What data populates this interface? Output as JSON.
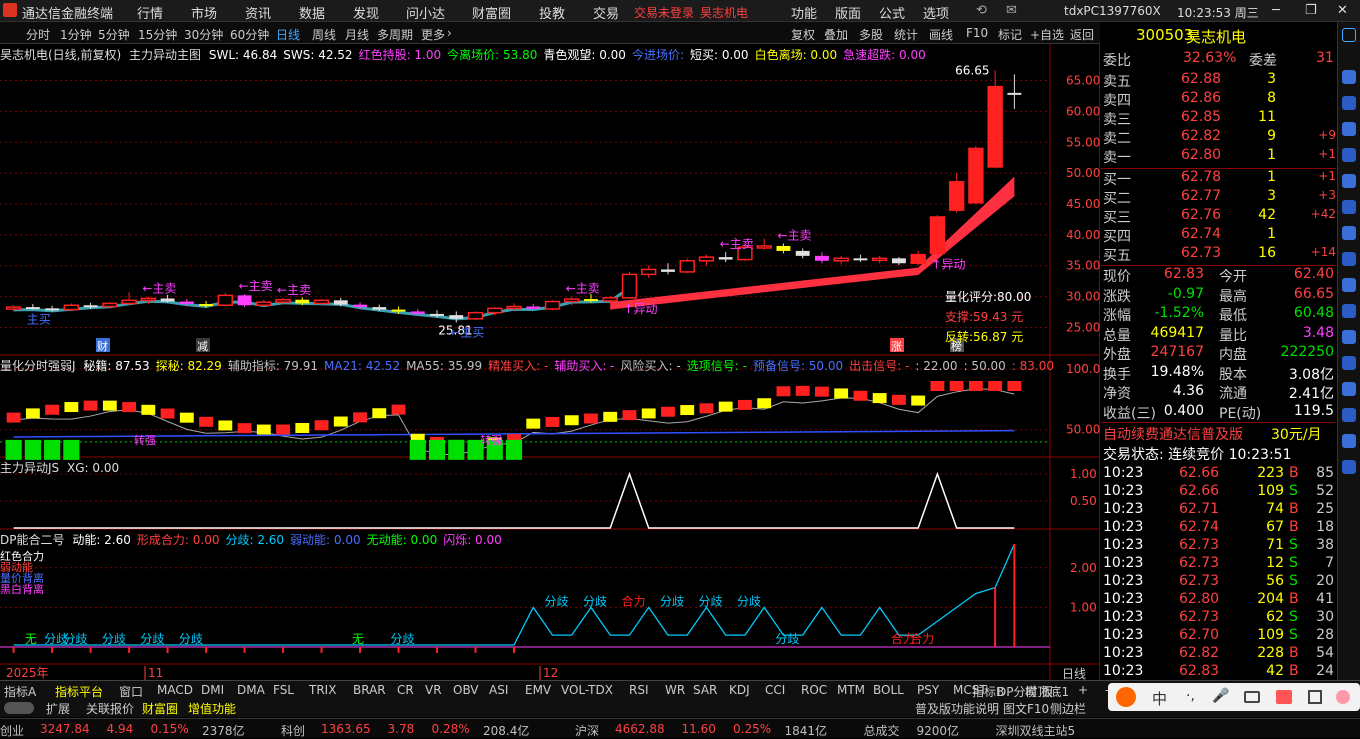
{
  "titlebar": {
    "app_name": "通达信金融终端",
    "menu": [
      "行情",
      "市场",
      "资讯",
      "数据",
      "发现",
      "问小达",
      "财富圈",
      "投教",
      "交易"
    ],
    "trade_notice": "交易未登录",
    "stock_name": "昊志机电",
    "right_menu": [
      "功能",
      "版面",
      "公式",
      "选项"
    ],
    "pc_id": "tdxPC1397760X",
    "clock": "10:23:53 周三"
  },
  "toolbar": {
    "periods": [
      "分时",
      "1分钟",
      "5分钟",
      "15分钟",
      "30分钟",
      "60分钟",
      "日线",
      "周线",
      "月线",
      "多周期",
      "更多"
    ],
    "active_period": "日线",
    "buttons": [
      "复权",
      "叠加",
      "多股",
      "统计",
      "画线",
      "F10",
      "标记",
      "+自选",
      "返回"
    ]
  },
  "main_chart": {
    "header": [
      "昊志机电(日线,前复权)",
      "主力异动主图"
    ],
    "indicators": [
      {
        "text": "SWL: 46.84",
        "color": "#ffffff"
      },
      {
        "text": "SWS: 42.52",
        "color": "#ffffff"
      },
      {
        "text": "红色持股: 1.00",
        "color": "#ff40ff"
      },
      {
        "text": "今离场价: 53.80",
        "color": "#00ff00"
      },
      {
        "text": "青色观望: 0.00",
        "color": "#ffffff"
      },
      {
        "text": "今进场价:",
        "color": "#4a6fff"
      },
      {
        "text": "短买: 0.00",
        "color": "#ffffff"
      },
      {
        "text": "白色离场: 0.00",
        "color": "#ffff00"
      },
      {
        "text": "急速超跌: 0.00",
        "color": "#ff40ff"
      }
    ],
    "price_axis": [
      "65.00",
      "60.00",
      "55.00",
      "50.00",
      "45.00",
      "40.00",
      "35.00",
      "30.00",
      "25.00"
    ],
    "high_label": "66.65",
    "low_label": "25.81",
    "quant_score": "量化评分:80.00",
    "support": "支撑:59.43 元",
    "reversal": "反转:56.87 元",
    "annotations": [
      "←主卖",
      "←主卖",
      "←主卖",
      "←主卖",
      "←主卖",
      "←主卖",
      "主买",
      "←主买",
      "↑异动",
      "↑异动"
    ],
    "markers": [
      "财",
      "减",
      "涨",
      "榜"
    ],
    "chart_data": {
      "type": "candlestick",
      "ylim": [
        22,
        68
      ],
      "ohlc": [
        [
          28.0,
          28.6,
          27.6,
          28.3
        ],
        [
          28.3,
          28.8,
          27.9,
          28.1
        ],
        [
          28.1,
          28.5,
          27.6,
          27.9
        ],
        [
          27.9,
          28.9,
          27.7,
          28.6
        ],
        [
          28.6,
          29.0,
          28.0,
          28.4
        ],
        [
          28.4,
          29.1,
          28.1,
          28.9
        ],
        [
          28.9,
          30.7,
          28.6,
          29.4
        ],
        [
          29.4,
          30.0,
          28.8,
          29.7
        ],
        [
          29.7,
          30.3,
          29.0,
          29.2
        ],
        [
          29.2,
          29.6,
          28.5,
          28.8
        ],
        [
          28.8,
          29.3,
          28.2,
          28.6
        ],
        [
          28.6,
          30.6,
          28.4,
          30.2
        ],
        [
          30.2,
          30.4,
          28.3,
          28.6
        ],
        [
          28.6,
          29.5,
          28.3,
          29.1
        ],
        [
          29.1,
          29.8,
          28.7,
          29.5
        ],
        [
          29.5,
          29.9,
          28.6,
          28.9
        ],
        [
          28.9,
          29.6,
          28.5,
          29.4
        ],
        [
          29.4,
          29.8,
          28.4,
          28.7
        ],
        [
          28.7,
          29.1,
          28.0,
          28.3
        ],
        [
          28.3,
          28.7,
          27.6,
          27.9
        ],
        [
          27.9,
          28.4,
          27.2,
          27.6
        ],
        [
          27.6,
          28.0,
          26.9,
          27.2
        ],
        [
          27.2,
          27.8,
          26.6,
          27.0
        ],
        [
          27.0,
          27.6,
          25.81,
          26.4
        ],
        [
          26.4,
          27.6,
          26.2,
          27.4
        ],
        [
          27.4,
          28.3,
          27.0,
          28.1
        ],
        [
          28.1,
          28.9,
          27.7,
          28.4
        ],
        [
          28.4,
          28.8,
          27.8,
          28.0
        ],
        [
          28.0,
          29.4,
          27.8,
          29.2
        ],
        [
          29.2,
          30.0,
          28.6,
          29.6
        ],
        [
          29.6,
          30.4,
          29.0,
          29.3
        ],
        [
          29.3,
          30.1,
          28.9,
          29.8
        ],
        [
          29.8,
          34.0,
          29.6,
          33.6
        ],
        [
          33.6,
          35.0,
          33.0,
          34.4
        ],
        [
          34.4,
          35.4,
          33.6,
          34.0
        ],
        [
          34.0,
          36.2,
          33.8,
          35.8
        ],
        [
          35.8,
          36.8,
          35.0,
          36.4
        ],
        [
          36.4,
          37.2,
          35.6,
          36.0
        ],
        [
          36.0,
          38.4,
          35.8,
          38.0
        ],
        [
          38.0,
          39.4,
          37.6,
          38.2
        ],
        [
          38.2,
          38.6,
          37.0,
          37.4
        ],
        [
          37.4,
          37.8,
          36.2,
          36.6
        ],
        [
          36.6,
          37.2,
          35.4,
          35.8
        ],
        [
          35.8,
          36.6,
          35.2,
          36.2
        ],
        [
          36.2,
          36.8,
          35.6,
          35.9
        ],
        [
          35.9,
          36.6,
          35.4,
          36.2
        ],
        [
          36.2,
          36.4,
          35.1,
          35.4
        ],
        [
          35.4,
          37.4,
          35.0,
          36.8
        ],
        [
          37.0,
          43.2,
          36.8,
          42.9
        ],
        [
          44.0,
          50.0,
          43.6,
          48.6
        ],
        [
          45.2,
          54.4,
          45.0,
          54.0
        ],
        [
          51.0,
          66.65,
          50.8,
          64.0
        ],
        [
          63.0,
          66.0,
          60.4,
          62.83
        ]
      ]
    }
  },
  "panel_qs": {
    "title": "量化分时强弱J",
    "values": [
      {
        "text": "秘籍: 87.53",
        "color": "#ffffff"
      },
      {
        "text": "探秘: 82.29",
        "color": "#ffff00"
      },
      {
        "text": "辅助指标: 79.91",
        "color": "#c0c0c0"
      },
      {
        "text": "MA21: 42.52",
        "color": "#4a6fff"
      },
      {
        "text": "MA55: 35.99",
        "color": "#c0c0c0"
      },
      {
        "text": "精准买入: -",
        "color": "#ff4040"
      },
      {
        "text": "辅助买入: -",
        "color": "#ff40ff"
      },
      {
        "text": "风险买入: -",
        "color": "#c0c0c0"
      },
      {
        "text": "选项信号: -",
        "color": "#00ff00"
      },
      {
        "text": "预备信号: 50.00",
        "color": "#4a6fff"
      },
      {
        "text": "出击信号: -",
        "color": "#ff4040"
      },
      {
        "text": ": 22.00",
        "color": "#c0c0c0"
      },
      {
        "text": ": 50.00",
        "color": "#c0c0c0"
      },
      {
        "text": ": 83.00",
        "color": "#ff4040"
      }
    ],
    "axis": [
      "100.0",
      "50.00"
    ],
    "labels": [
      "转强",
      "转强",
      "转强"
    ]
  },
  "panel_js": {
    "title": "主力异动JS",
    "value": "XG: 0.00",
    "axis": [
      "1.00",
      "0.50"
    ]
  },
  "panel_dp": {
    "title": "DP能合二号",
    "values": [
      {
        "text": "动能: 2.60",
        "color": "#ffffff"
      },
      {
        "text": "形成合力: 0.00",
        "color": "#ff4040"
      },
      {
        "text": "分歧: 2.60",
        "color": "#00ccff"
      },
      {
        "text": "弱动能: 0.00",
        "color": "#4a6fff"
      },
      {
        "text": "无动能: 0.00",
        "color": "#00ff00"
      },
      {
        "text": "闪烁: 0.00",
        "color": "#ff40ff"
      }
    ],
    "axis": [
      "2.00",
      "1.00"
    ],
    "left_legend": [
      "红色合力",
      "弱动能",
      "量价背离",
      "黑白背离"
    ],
    "labels": [
      "无",
      "分歧",
      "分歧",
      "分歧",
      "分歧",
      "分歧",
      "无",
      "分歧",
      "分歧",
      "分歧",
      "合力",
      "分歧",
      "分歧",
      "分歧",
      "分歧",
      "合力",
      "合力"
    ],
    "dates": [
      "2025年",
      "11",
      "12"
    ],
    "period_tag": "日线"
  },
  "quote": {
    "code": "300503",
    "name": "昊志机电",
    "wei_bi_label": "委比",
    "wei_bi": "32.63%",
    "wei_cha_label": "委差",
    "wei_cha": "31",
    "asks": [
      {
        "label": "卖五",
        "price": "62.88",
        "vol": "3",
        "chg": ""
      },
      {
        "label": "卖四",
        "price": "62.86",
        "vol": "8",
        "chg": ""
      },
      {
        "label": "卖三",
        "price": "62.85",
        "vol": "11",
        "chg": ""
      },
      {
        "label": "卖二",
        "price": "62.82",
        "vol": "9",
        "chg": "+9"
      },
      {
        "label": "卖一",
        "price": "62.80",
        "vol": "1",
        "chg": "+1"
      }
    ],
    "bids": [
      {
        "label": "买一",
        "price": "62.78",
        "vol": "1",
        "chg": "+1"
      },
      {
        "label": "买二",
        "price": "62.77",
        "vol": "3",
        "chg": "+3"
      },
      {
        "label": "买三",
        "price": "62.76",
        "vol": "42",
        "chg": "+42"
      },
      {
        "label": "买四",
        "price": "62.74",
        "vol": "1",
        "chg": ""
      },
      {
        "label": "买五",
        "price": "62.73",
        "vol": "16",
        "chg": "+14"
      }
    ],
    "stats": [
      {
        "l1": "现价",
        "v1": "62.83",
        "c1": "#ff4040",
        "l2": "今开",
        "v2": "62.40",
        "c2": "#ff4040"
      },
      {
        "l1": "涨跌",
        "v1": "-0.97",
        "c1": "#00e000",
        "l2": "最高",
        "v2": "66.65",
        "c2": "#ff4040"
      },
      {
        "l1": "涨幅",
        "v1": "-1.52%",
        "c1": "#00e000",
        "l2": "最低",
        "v2": "60.48",
        "c2": "#00e000"
      },
      {
        "l1": "总量",
        "v1": "469417",
        "c1": "#ffff00",
        "l2": "量比",
        "v2": "3.48",
        "c2": "#ff40ff"
      },
      {
        "l1": "外盘",
        "v1": "247167",
        "c1": "#ff4040",
        "l2": "内盘",
        "v2": "222250",
        "c2": "#00e000"
      },
      {
        "l1": "换手",
        "v1": "19.48%",
        "c1": "#ffffff",
        "l2": "股本",
        "v2": "3.08亿",
        "c2": "#ffffff"
      },
      {
        "l1": "净资",
        "v1": "4.36",
        "c1": "#ffffff",
        "l2": "流通",
        "v2": "2.41亿",
        "c2": "#ffffff"
      },
      {
        "l1": "收益(三)",
        "v1": "0.400",
        "c1": "#ffffff",
        "l2": "PE(动)",
        "v2": "119.5",
        "c2": "#ffffff"
      }
    ],
    "ad_text": "自动续费通达信普及版",
    "ad_price": "30元/月",
    "trade_state": "交易状态: 连续竞价 10:23:51",
    "ticks": [
      {
        "t": "10:23",
        "p": "62.66",
        "v": "223",
        "d": "B",
        "n": "85"
      },
      {
        "t": "10:23",
        "p": "62.66",
        "v": "109",
        "d": "S",
        "n": "52"
      },
      {
        "t": "10:23",
        "p": "62.71",
        "v": "74",
        "d": "B",
        "n": "25"
      },
      {
        "t": "10:23",
        "p": "62.74",
        "v": "67",
        "d": "B",
        "n": "18"
      },
      {
        "t": "10:23",
        "p": "62.73",
        "v": "71",
        "d": "S",
        "n": "38"
      },
      {
        "t": "10:23",
        "p": "62.73",
        "v": "12",
        "d": "S",
        "n": "7"
      },
      {
        "t": "10:23",
        "p": "62.73",
        "v": "56",
        "d": "S",
        "n": "20"
      },
      {
        "t": "10:23",
        "p": "62.80",
        "v": "204",
        "d": "B",
        "n": "41"
      },
      {
        "t": "10:23",
        "p": "62.73",
        "v": "62",
        "d": "S",
        "n": "30"
      },
      {
        "t": "10:23",
        "p": "62.70",
        "v": "109",
        "d": "S",
        "n": "28"
      },
      {
        "t": "10:23",
        "p": "62.82",
        "v": "228",
        "d": "B",
        "n": "54"
      },
      {
        "t": "10:23",
        "p": "62.83",
        "v": "42",
        "d": "B",
        "n": "24"
      }
    ]
  },
  "bottom_tabs": [
    "指标A",
    "指标平台",
    "窗口",
    "MACD",
    "DMI",
    "DMA",
    "FSL",
    "TRIX",
    "BRAR",
    "CR",
    "VR",
    "OBV",
    "ASI",
    "EMV",
    "VOL-TDX",
    "RSI",
    "WR",
    "SAR",
    "KDJ",
    "CCI",
    "ROC",
    "MTM",
    "BOLL",
    "PSY",
    "MCST",
    "DP分时顶底1"
  ],
  "bottom_right_tabs": [
    "指标B",
    "模 板",
    "+",
    "-"
  ],
  "bottom2": {
    "items": [
      "扩展",
      "关联报价",
      "财富圈",
      "增值功能"
    ],
    "right": [
      "普及版功能说明",
      "图文F10",
      "侧边栏"
    ]
  },
  "ime": [
    "中",
    "·,",
    "🎤"
  ],
  "statusbar": [
    {
      "text": "创业",
      "color": "#c0c0c0"
    },
    {
      "text": "3247.84",
      "color": "#ff4040"
    },
    {
      "text": "4.94",
      "color": "#ff4040"
    },
    {
      "text": "0.15%",
      "color": "#ff4040"
    },
    {
      "text": "2378亿",
      "color": "#c0c0c0"
    },
    {
      "text": "科创",
      "color": "#c0c0c0"
    },
    {
      "text": "1363.65",
      "color": "#ff4040"
    },
    {
      "text": "3.78",
      "color": "#ff4040"
    },
    {
      "text": "0.28%",
      "color": "#ff4040"
    },
    {
      "text": "208.4亿",
      "color": "#c0c0c0"
    },
    {
      "text": "沪深",
      "color": "#c0c0c0"
    },
    {
      "text": "4662.88",
      "color": "#ff4040"
    },
    {
      "text": "11.60",
      "color": "#ff4040"
    },
    {
      "text": "0.25%",
      "color": "#ff4040"
    },
    {
      "text": "1841亿",
      "color": "#c0c0c0"
    },
    {
      "text": "总成交",
      "color": "#c0c0c0"
    },
    {
      "text": "9200亿",
      "color": "#c0c0c0"
    },
    {
      "text": "深圳双线主站5",
      "color": "#c0c0c0"
    }
  ]
}
